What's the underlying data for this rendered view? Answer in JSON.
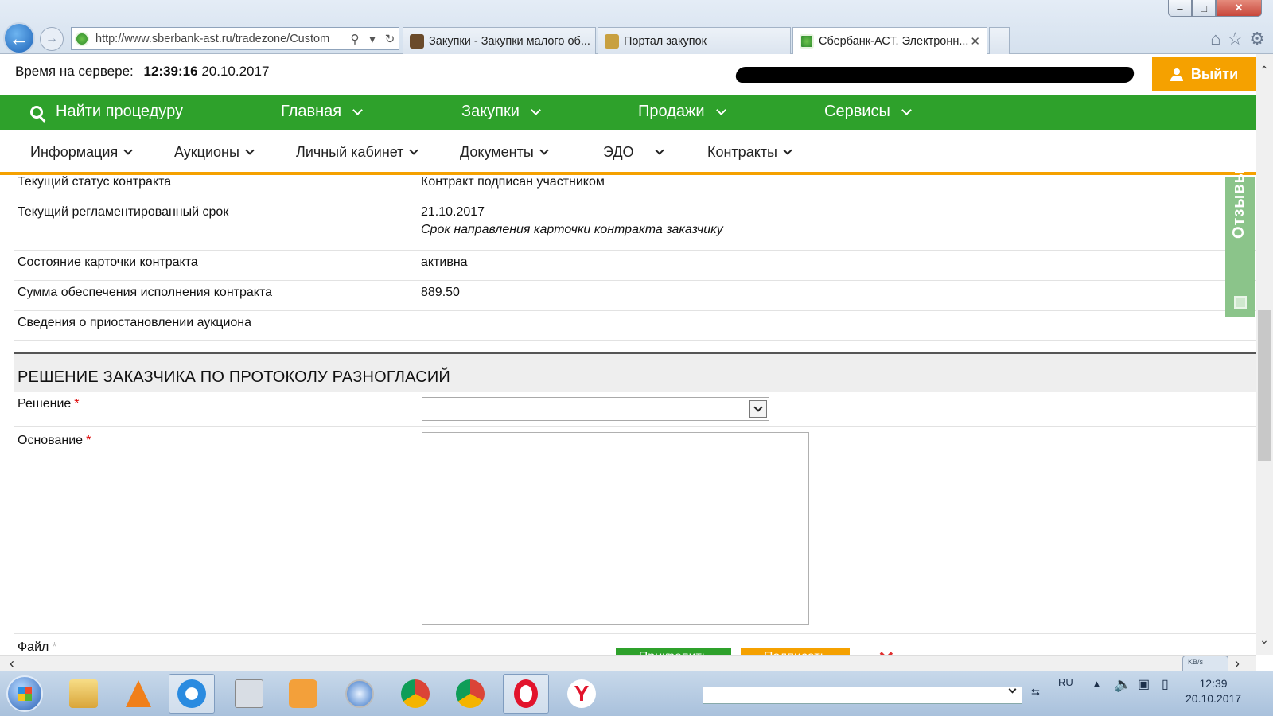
{
  "browser": {
    "url": "http://www.sberbank-ast.ru/tradezone/Custom",
    "tabs": [
      {
        "label": "Закупки - Закупки малого об..."
      },
      {
        "label": "Портал закупок"
      },
      {
        "label": "Сбербанк-АСТ. Электронн..."
      }
    ],
    "tab_close": "✕",
    "win_min": "–",
    "win_max": "□",
    "win_close": "✕"
  },
  "header": {
    "server_time_label": "Время на сервере:",
    "server_time": "12:39:16",
    "server_date": "20.10.2017",
    "logout_label": "Выйти"
  },
  "main_nav": {
    "search_label": "Найти процедуру",
    "items": [
      {
        "label": "Главная"
      },
      {
        "label": "Закупки"
      },
      {
        "label": "Продажи"
      },
      {
        "label": "Сервисы"
      }
    ]
  },
  "sub_nav": {
    "items": [
      {
        "label": "Информация"
      },
      {
        "label": "Аукционы"
      },
      {
        "label": "Личный кабинет"
      },
      {
        "label": "Документы"
      },
      {
        "label": "ЭДО"
      },
      {
        "label": "Контракты"
      }
    ]
  },
  "details": {
    "rows": [
      {
        "label": "Текущий статус контракта",
        "value": "Контракт подписан участником",
        "sub": ""
      },
      {
        "label": "Текущий регламентированный срок",
        "value": "21.10.2017",
        "sub": "Срок направления карточки контракта заказчику"
      },
      {
        "label": "Состояние карточки контракта",
        "value": "активна",
        "sub": ""
      },
      {
        "label": "Сумма обеспечения исполнения контракта",
        "value": "889.50",
        "sub": ""
      },
      {
        "label": "Сведения о приостановлении аукциона",
        "value": "",
        "sub": ""
      }
    ]
  },
  "decision_section": {
    "title": "РЕШЕНИЕ ЗАКАЗЧИКА ПО ПРОТОКОЛУ РАЗНОГЛАСИЙ",
    "decision_label": "Решение",
    "decision_value": "",
    "basis_label": "Основание",
    "basis_value": "",
    "file_label": "Файл",
    "required_mark": "*",
    "attach_label": "Прикрепить",
    "sign_label": "Подписать",
    "remove_mark": "✕"
  },
  "feedback_label": "Отзывы",
  "taskbar": {
    "lang": "RU",
    "clock_time": "12:39",
    "clock_date": "20.10.2017",
    "kb_label": "KB/s"
  },
  "colors": {
    "green": "#2ea12b",
    "orange": "#f5a100"
  }
}
